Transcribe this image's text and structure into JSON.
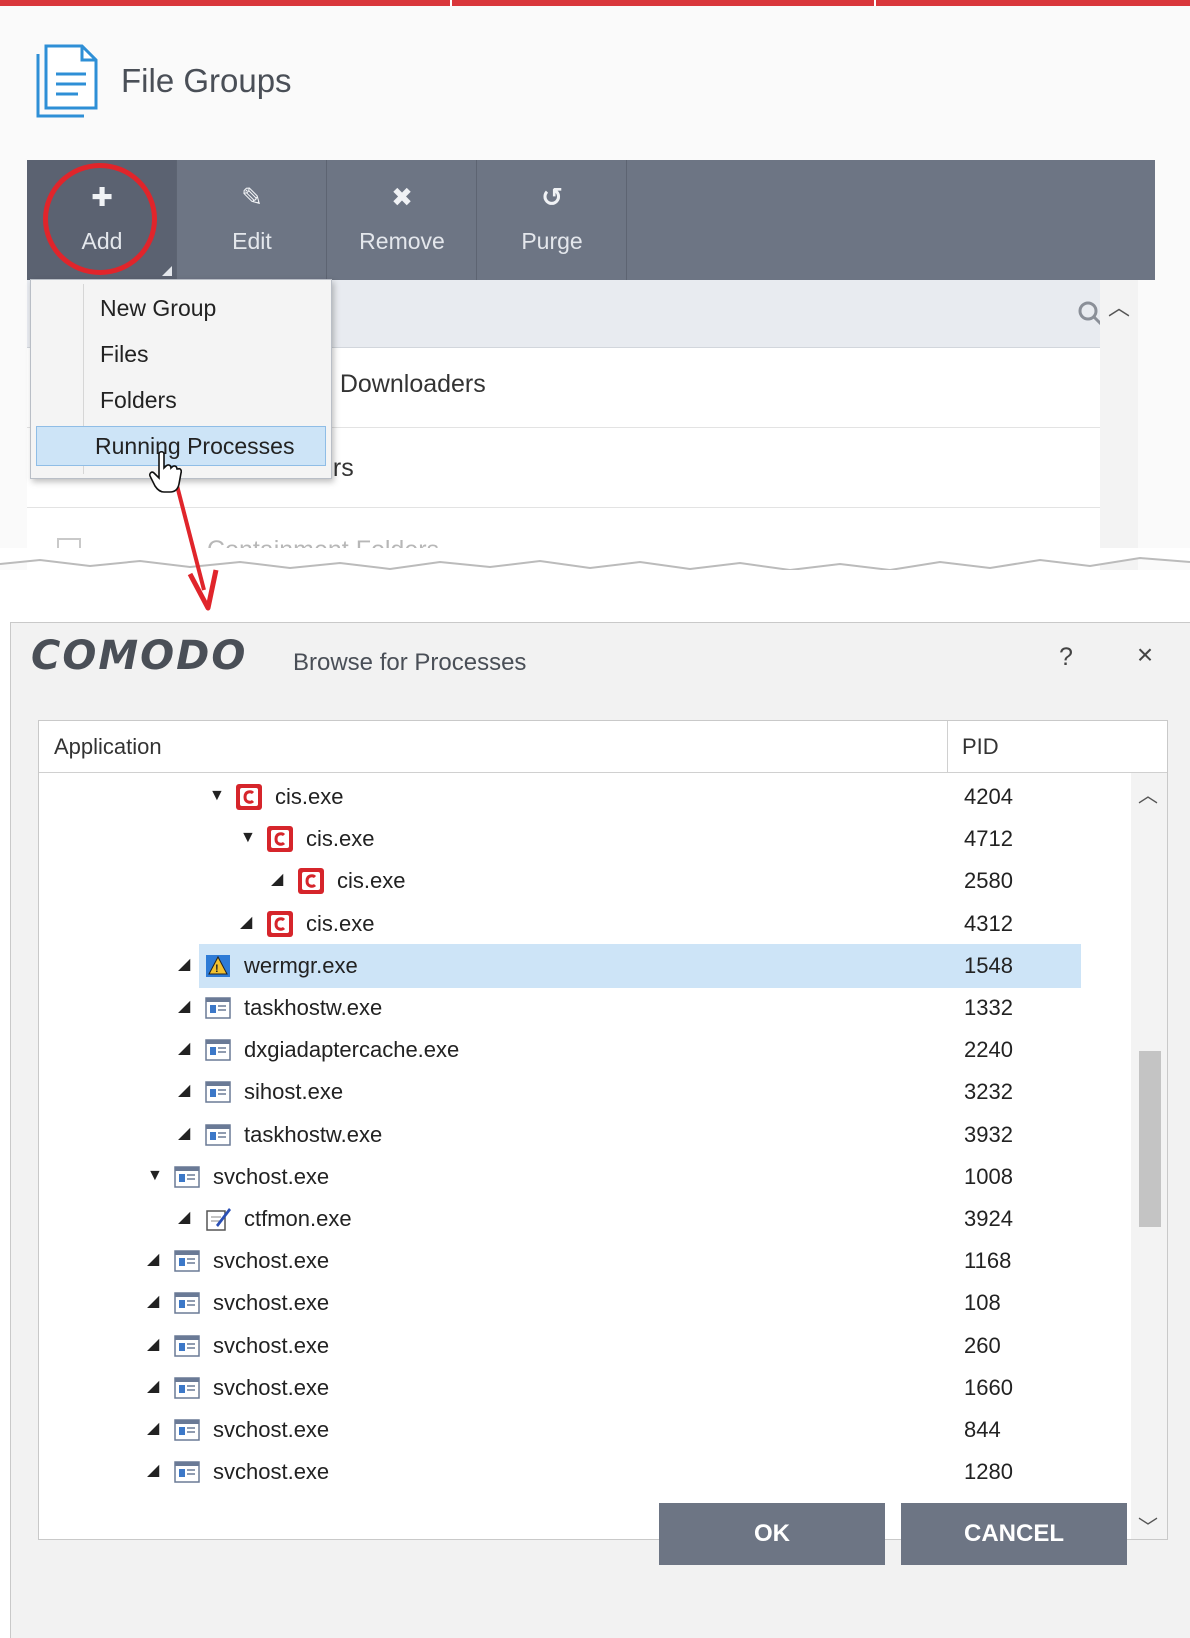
{
  "file_groups": {
    "title": "File Groups",
    "toolbar": [
      {
        "label": "Add",
        "icon": "plus-icon"
      },
      {
        "label": "Edit",
        "icon": "pencil-icon"
      },
      {
        "label": "Remove",
        "icon": "x-icon"
      },
      {
        "label": "Purge",
        "icon": "refresh-icon"
      }
    ],
    "rows": [
      {
        "name_partial": "e Downloaders"
      },
      {
        "name_partial": "ers"
      },
      {
        "name_partial": "Containment Folders"
      }
    ],
    "add_menu": [
      "New Group",
      "Files",
      "Folders",
      "Running Processes"
    ]
  },
  "dialog": {
    "brand": "COMODO",
    "title": "Browse for Processes",
    "help": "?",
    "close": "×",
    "columns": {
      "application": "Application",
      "pid": "PID"
    },
    "processes": [
      {
        "name": "cis.exe",
        "pid": "4204",
        "icon": "comodo-icon",
        "expander": "expanded"
      },
      {
        "name": "cis.exe",
        "pid": "4712",
        "icon": "comodo-icon",
        "expander": "expanded"
      },
      {
        "name": "cis.exe",
        "pid": "2580",
        "icon": "comodo-icon",
        "expander": "leaf"
      },
      {
        "name": "cis.exe",
        "pid": "4312",
        "icon": "comodo-icon",
        "expander": "leaf"
      },
      {
        "name": "wermgr.exe",
        "pid": "1548",
        "icon": "wermgr-icon",
        "expander": "leaf",
        "selected": true
      },
      {
        "name": "taskhostw.exe",
        "pid": "1332",
        "icon": "app-window-icon",
        "expander": "leaf"
      },
      {
        "name": "dxgiadaptercache.exe",
        "pid": "2240",
        "icon": "app-window-icon",
        "expander": "leaf"
      },
      {
        "name": "sihost.exe",
        "pid": "3232",
        "icon": "app-window-icon",
        "expander": "leaf"
      },
      {
        "name": "taskhostw.exe",
        "pid": "3932",
        "icon": "app-window-icon",
        "expander": "leaf"
      },
      {
        "name": "svchost.exe",
        "pid": "1008",
        "icon": "app-window-icon",
        "expander": "expanded"
      },
      {
        "name": "ctfmon.exe",
        "pid": "3924",
        "icon": "ctfmon-icon",
        "expander": "leaf"
      },
      {
        "name": "svchost.exe",
        "pid": "1168",
        "icon": "app-window-icon",
        "expander": "leaf"
      },
      {
        "name": "svchost.exe",
        "pid": "108",
        "icon": "app-window-icon",
        "expander": "leaf"
      },
      {
        "name": "svchost.exe",
        "pid": "260",
        "icon": "app-window-icon",
        "expander": "leaf"
      },
      {
        "name": "svchost.exe",
        "pid": "1660",
        "icon": "app-window-icon",
        "expander": "leaf"
      },
      {
        "name": "svchost.exe",
        "pid": "844",
        "icon": "app-window-icon",
        "expander": "leaf"
      },
      {
        "name": "svchost.exe",
        "pid": "1280",
        "icon": "app-window-icon",
        "expander": "leaf"
      }
    ],
    "buttons": {
      "ok": "OK",
      "cancel": "CANCEL"
    }
  },
  "colors": {
    "toolbar": "#6d7584",
    "accent_red": "#e0252b",
    "selection": "#cde4f7"
  }
}
